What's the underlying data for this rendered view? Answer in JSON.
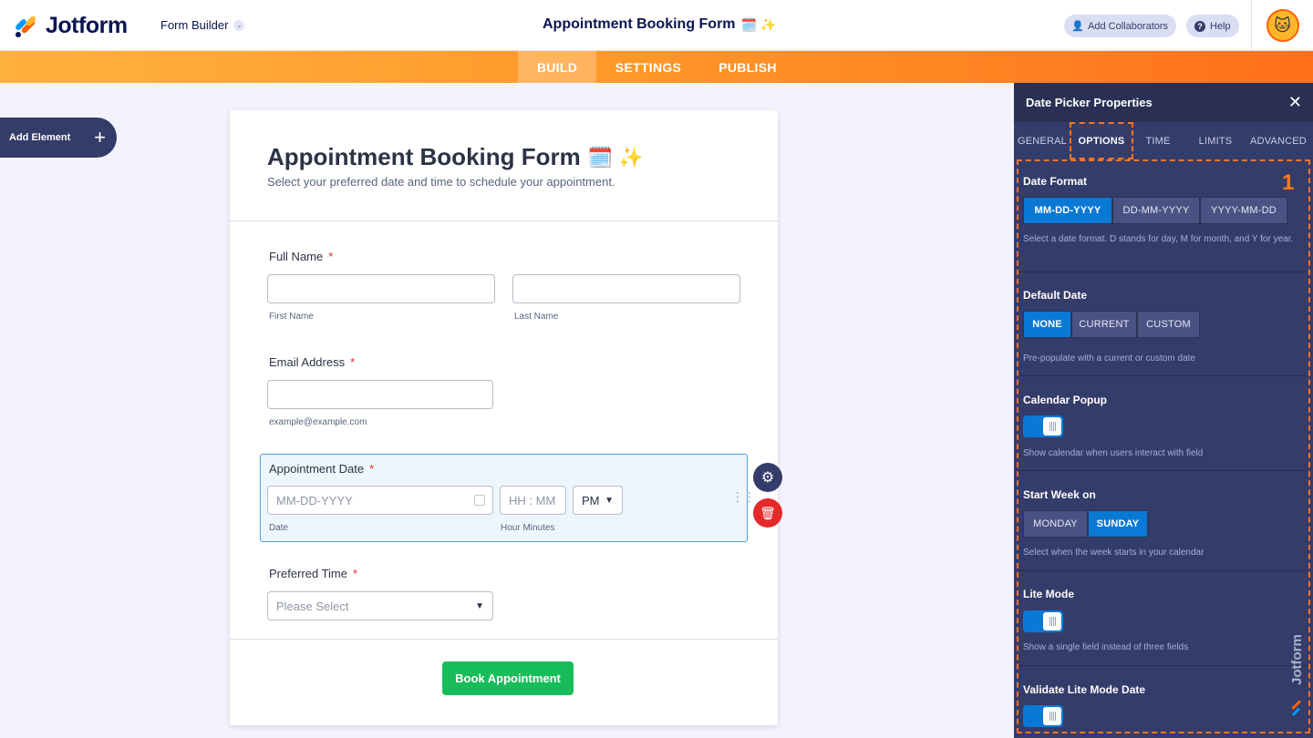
{
  "header": {
    "logo_text": "Jotform",
    "form_builder_label": "Form Builder",
    "title": "Appointment Booking Form",
    "title_emojis": "🗓️ ✨",
    "add_collaborators": "Add Collaborators",
    "help": "Help"
  },
  "nav": {
    "tabs": [
      {
        "label": "BUILD",
        "active": true
      },
      {
        "label": "SETTINGS",
        "active": false
      },
      {
        "label": "PUBLISH",
        "active": false
      }
    ]
  },
  "add_element": {
    "label": "Add Element"
  },
  "form": {
    "title": "Appointment Booking Form",
    "title_emojis": "🗓️ ✨",
    "subtitle": "Select your preferred date and time to schedule your appointment.",
    "full_name": {
      "label": "Full Name",
      "required": "*",
      "first_sub": "First Name",
      "last_sub": "Last Name"
    },
    "email": {
      "label": "Email Address",
      "required": "*",
      "sub": "example@example.com"
    },
    "appointment_date": {
      "label": "Appointment Date",
      "required": "*",
      "date_placeholder": "MM-DD-YYYY",
      "time_placeholder": "HH : MM",
      "ampm": "PM",
      "date_sub": "Date",
      "time_sub": "Hour Minutes"
    },
    "preferred_time": {
      "label": "Preferred Time",
      "required": "*",
      "placeholder": "Please Select"
    },
    "submit": "Book Appointment"
  },
  "panel": {
    "title": "Date Picker Properties",
    "tabs": [
      "GENERAL",
      "OPTIONS",
      "TIME",
      "LIMITS",
      "ADVANCED"
    ],
    "active_tab": "OPTIONS",
    "annotation": "1",
    "date_format": {
      "title": "Date Format",
      "options": [
        "MM-DD-YYYY",
        "DD-MM-YYYY",
        "YYYY-MM-DD"
      ],
      "selected": "MM-DD-YYYY",
      "help": "Select a date format. D stands for day, M for month, and Y for year."
    },
    "default_date": {
      "title": "Default Date",
      "options": [
        "NONE",
        "CURRENT",
        "CUSTOM"
      ],
      "selected": "NONE",
      "help": "Pre-populate with a current or custom date"
    },
    "calendar_popup": {
      "title": "Calendar Popup",
      "enabled": true,
      "help": "Show calendar when users interact with field"
    },
    "start_week": {
      "title": "Start Week on",
      "options": [
        "MONDAY",
        "SUNDAY"
      ],
      "selected": "SUNDAY",
      "help": "Select when the week starts in your calendar"
    },
    "lite_mode": {
      "title": "Lite Mode",
      "enabled": true,
      "help": "Show a single field instead of three fields"
    },
    "validate_lite": {
      "title": "Validate Lite Mode Date",
      "enabled": true
    }
  },
  "colors": {
    "accent_orange": "#ff6100",
    "panel_bg": "#343c6a",
    "selected_blue": "#0a79d6",
    "submit_green": "#18bd5b"
  }
}
